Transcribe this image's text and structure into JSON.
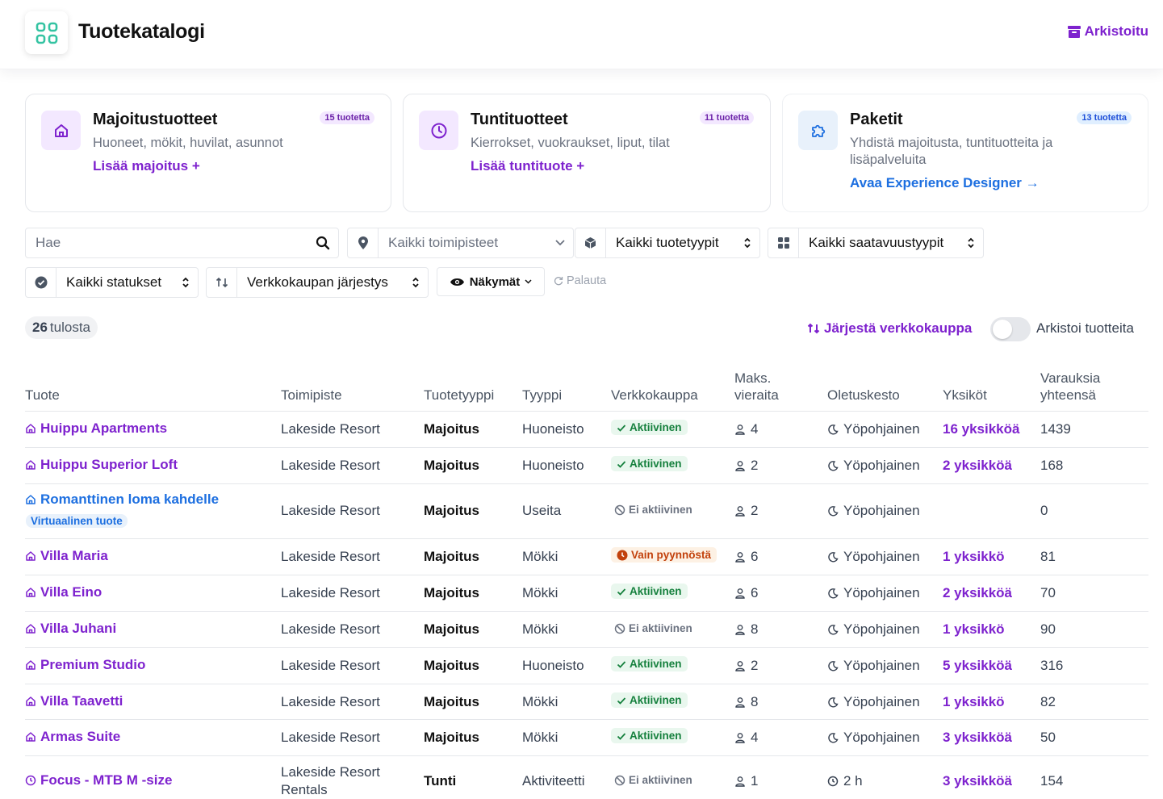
{
  "header": {
    "title": "Tuotekatalogi",
    "archived_label": "Arkistoitu"
  },
  "cards": [
    {
      "title": "Majoitustuotteet",
      "badge": "15 tuotetta",
      "description": "Huoneet, mökit, huvilat, asunnot",
      "link": "Lisää majoitus +"
    },
    {
      "title": "Tuntituotteet",
      "badge": "11 tuotetta",
      "description": "Kierrokset, vuokraukset, liput, tilat",
      "link": "Lisää tuntituote +"
    },
    {
      "title": "Paketit",
      "badge": "13 tuotetta",
      "description": "Yhdistä majoitusta, tuntituotteita ja lisäpalveluita",
      "link": "Avaa Experience Designer →"
    }
  ],
  "filters": {
    "search_placeholder": "Hae",
    "location": "Kaikki toimipisteet",
    "product_type": "Kaikki tuotetyypit",
    "availability": "Kaikki saatavuustyypit",
    "status": "Kaikki statukset",
    "sort": "Verkkokaupan järjestys",
    "views": "Näkymät",
    "reset": "Palauta"
  },
  "results": {
    "count": "26",
    "suffix": "tulosta",
    "sort_shop": "Järjestä verkkokauppa",
    "archive_toggle_label": "Arkistoi tuotteita"
  },
  "table": {
    "headers": {
      "product": "Tuote",
      "location": "Toimipiste",
      "product_type": "Tuotetyyppi",
      "type": "Tyyppi",
      "webshop": "Verkkokauppa",
      "max_guests_1": "Maks.",
      "max_guests_2": "vieraita",
      "default_duration": "Oletuskesto",
      "units": "Yksiköt",
      "bookings_1": "Varauksia",
      "bookings_2": "yhteensä"
    },
    "virtual_badge": "Virtuaalinen tuote",
    "rows": [
      {
        "name": "Huippu Apartments",
        "location": "Lakeside Resort",
        "product_type": "Majoitus",
        "type": "Huoneisto",
        "status": "Aktiivinen",
        "guests": "4",
        "duration": "Yöpohjainen",
        "units": "16 yksikköä",
        "bookings": "1439"
      },
      {
        "name": "Huippu Superior Loft",
        "location": "Lakeside Resort",
        "product_type": "Majoitus",
        "type": "Huoneisto",
        "status": "Aktiivinen",
        "guests": "2",
        "duration": "Yöpohjainen",
        "units": "2 yksikköä",
        "bookings": "168"
      },
      {
        "name": "Romanttinen loma kahdelle",
        "location": "Lakeside Resort",
        "product_type": "Majoitus",
        "type": "Useita",
        "status": "Ei aktiivinen",
        "guests": "2",
        "duration": "Yöpohjainen",
        "units": "",
        "bookings": "0"
      },
      {
        "name": "Villa Maria",
        "location": "Lakeside Resort",
        "product_type": "Majoitus",
        "type": "Mökki",
        "status": "Vain pyynnöstä",
        "guests": "6",
        "duration": "Yöpohjainen",
        "units": "1 yksikkö",
        "bookings": "81"
      },
      {
        "name": "Villa Eino",
        "location": "Lakeside Resort",
        "product_type": "Majoitus",
        "type": "Mökki",
        "status": "Aktiivinen",
        "guests": "6",
        "duration": "Yöpohjainen",
        "units": "2 yksikköä",
        "bookings": "70"
      },
      {
        "name": "Villa Juhani",
        "location": "Lakeside Resort",
        "product_type": "Majoitus",
        "type": "Mökki",
        "status": "Ei aktiivinen",
        "guests": "8",
        "duration": "Yöpohjainen",
        "units": "1 yksikkö",
        "bookings": "90"
      },
      {
        "name": "Premium Studio",
        "location": "Lakeside Resort",
        "product_type": "Majoitus",
        "type": "Huoneisto",
        "status": "Aktiivinen",
        "guests": "2",
        "duration": "Yöpohjainen",
        "units": "5 yksikköä",
        "bookings": "316"
      },
      {
        "name": "Villa Taavetti",
        "location": "Lakeside Resort",
        "product_type": "Majoitus",
        "type": "Mökki",
        "status": "Aktiivinen",
        "guests": "8",
        "duration": "Yöpohjainen",
        "units": "1 yksikkö",
        "bookings": "82"
      },
      {
        "name": "Armas Suite",
        "location": "Lakeside Resort",
        "product_type": "Majoitus",
        "type": "Mökki",
        "status": "Aktiivinen",
        "guests": "4",
        "duration": "Yöpohjainen",
        "units": "3 yksikköä",
        "bookings": "50"
      },
      {
        "name": "Focus - MTB M -size",
        "location_1": "Lakeside Resort",
        "location_2": "Rentals",
        "product_type": "Tunti",
        "type": "Aktiviteetti",
        "status": "Ei aktiivinen",
        "guests": "1",
        "duration": "2 h",
        "units": "3 yksikköä",
        "bookings": "154"
      }
    ]
  }
}
